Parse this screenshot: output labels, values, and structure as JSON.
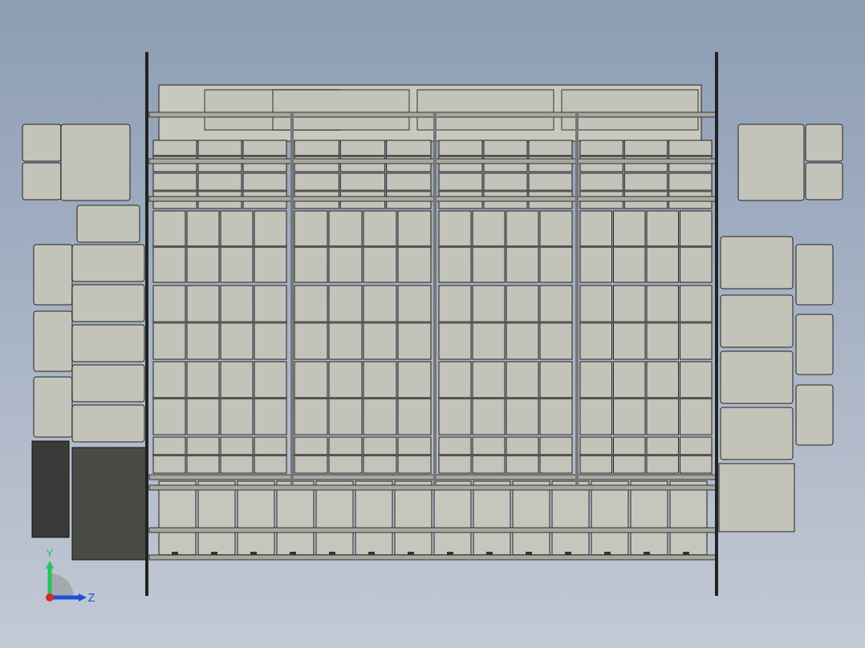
{
  "viewport": {
    "triad": {
      "axes": [
        {
          "kind": "y",
          "label": "Y"
        },
        {
          "kind": "z",
          "label": "Z"
        }
      ]
    }
  }
}
